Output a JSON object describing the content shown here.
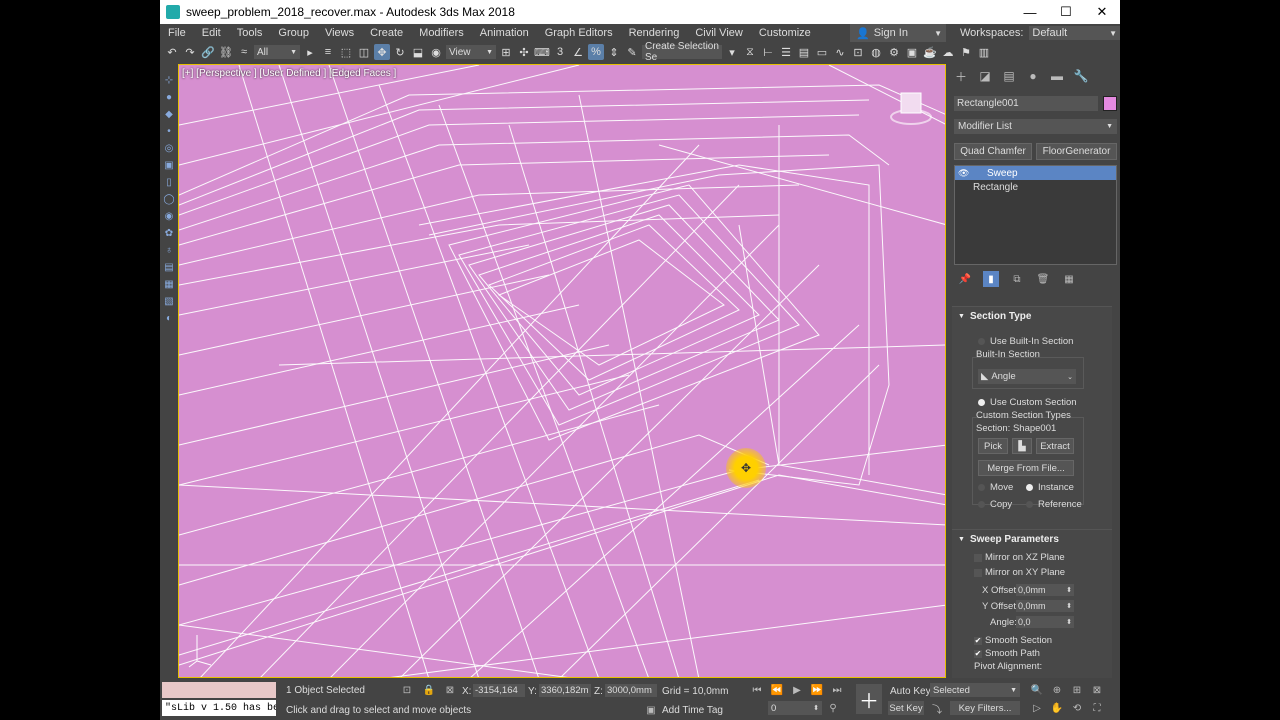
{
  "window": {
    "title": "sweep_problem_2018_recover.max - Autodesk 3ds Max 2018",
    "minimize": "—",
    "maximize": "☐",
    "close": "✕"
  },
  "menu": {
    "items": [
      "File",
      "Edit",
      "Tools",
      "Group",
      "Views",
      "Create",
      "Modifiers",
      "Animation",
      "Graph Editors",
      "Rendering",
      "Civil View",
      "Customize"
    ],
    "signin": "Sign In",
    "workspaces_label": "Workspaces:",
    "workspaces_value": "Default"
  },
  "toolbar": {
    "filter_select": "All",
    "refcoord_select": "View",
    "selection_set": "Create Selection Se"
  },
  "viewport": {
    "label": "[+] [Perspective ] [User Defined ] [Edged Faces ]",
    "background_color": "#d68fd0"
  },
  "command_panel": {
    "object_name": "Rectangle001",
    "object_color": "#e48ae0",
    "modifier_list": "Modifier List",
    "buttons": [
      "Quad Chamfer",
      "FloorGenerator"
    ],
    "stack": [
      {
        "label": "Sweep",
        "selected": true
      },
      {
        "label": "Rectangle",
        "selected": false
      }
    ],
    "section_type": {
      "title": "Section Type",
      "use_builtin": "Use Built-In Section",
      "builtin_label": "Built-In Section",
      "builtin_value": "Angle",
      "use_custom": "Use Custom Section",
      "custom_types": "Custom Section Types",
      "section": "Section: Shape001",
      "pick": "Pick",
      "extract": "Extract",
      "merge": "Merge From File...",
      "move": "Move",
      "instance": "Instance",
      "copy": "Copy",
      "reference": "Reference"
    },
    "sweep_params": {
      "title": "Sweep Parameters",
      "mirror_xz": "Mirror on XZ Plane",
      "mirror_xy": "Mirror on XY Plane",
      "x_offset_label": "X Offset:",
      "x_offset": "0,0mm",
      "y_offset_label": "Y Offset:",
      "y_offset": "0,0mm",
      "angle_label": "Angle:",
      "angle": "0,0",
      "smooth_section": "Smooth Section",
      "smooth_path": "Smooth Path",
      "pivot_alignment": "Pivot Alignment:"
    }
  },
  "statusbar": {
    "script_line": "\"sLib v 1.50 has bee",
    "selection_count": "1 Object Selected",
    "prompt": "Click and drag to select and move objects",
    "x_label": "X:",
    "x_value": "-3154,164",
    "y_label": "Y:",
    "y_value": "3360,182m",
    "z_label": "Z:",
    "z_value": "3000,0mm",
    "grid": "Grid = 10,0mm",
    "add_time_tag": "Add Time Tag",
    "frame": "0",
    "auto_key": "Auto Key",
    "set_key": "Set Key",
    "selected": "Selected",
    "key_filters": "Key Filters..."
  }
}
